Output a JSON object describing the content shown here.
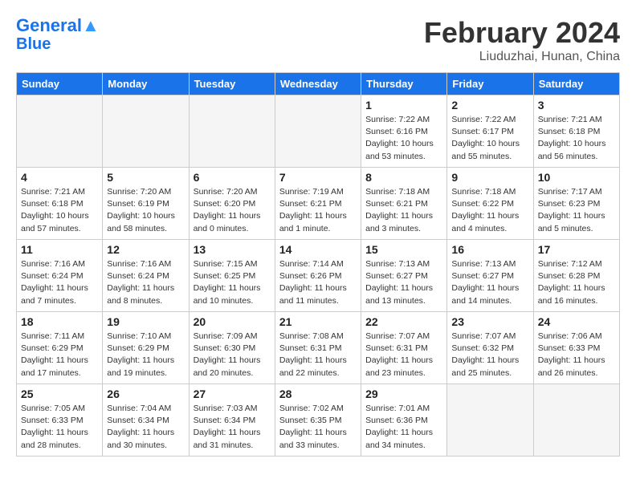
{
  "header": {
    "logo_line1": "General",
    "logo_line2": "Blue",
    "month_year": "February 2024",
    "location": "Liuduzhai, Hunan, China"
  },
  "days_of_week": [
    "Sunday",
    "Monday",
    "Tuesday",
    "Wednesday",
    "Thursday",
    "Friday",
    "Saturday"
  ],
  "weeks": [
    [
      {
        "day": "",
        "empty": true
      },
      {
        "day": "",
        "empty": true
      },
      {
        "day": "",
        "empty": true
      },
      {
        "day": "",
        "empty": true
      },
      {
        "day": "1",
        "sunrise": "7:22 AM",
        "sunset": "6:16 PM",
        "daylight": "10 hours and 53 minutes."
      },
      {
        "day": "2",
        "sunrise": "7:22 AM",
        "sunset": "6:17 PM",
        "daylight": "10 hours and 55 minutes."
      },
      {
        "day": "3",
        "sunrise": "7:21 AM",
        "sunset": "6:18 PM",
        "daylight": "10 hours and 56 minutes."
      }
    ],
    [
      {
        "day": "4",
        "sunrise": "7:21 AM",
        "sunset": "6:18 PM",
        "daylight": "10 hours and 57 minutes."
      },
      {
        "day": "5",
        "sunrise": "7:20 AM",
        "sunset": "6:19 PM",
        "daylight": "10 hours and 58 minutes."
      },
      {
        "day": "6",
        "sunrise": "7:20 AM",
        "sunset": "6:20 PM",
        "daylight": "11 hours and 0 minutes."
      },
      {
        "day": "7",
        "sunrise": "7:19 AM",
        "sunset": "6:21 PM",
        "daylight": "11 hours and 1 minute."
      },
      {
        "day": "8",
        "sunrise": "7:18 AM",
        "sunset": "6:21 PM",
        "daylight": "11 hours and 3 minutes."
      },
      {
        "day": "9",
        "sunrise": "7:18 AM",
        "sunset": "6:22 PM",
        "daylight": "11 hours and 4 minutes."
      },
      {
        "day": "10",
        "sunrise": "7:17 AM",
        "sunset": "6:23 PM",
        "daylight": "11 hours and 5 minutes."
      }
    ],
    [
      {
        "day": "11",
        "sunrise": "7:16 AM",
        "sunset": "6:24 PM",
        "daylight": "11 hours and 7 minutes."
      },
      {
        "day": "12",
        "sunrise": "7:16 AM",
        "sunset": "6:24 PM",
        "daylight": "11 hours and 8 minutes."
      },
      {
        "day": "13",
        "sunrise": "7:15 AM",
        "sunset": "6:25 PM",
        "daylight": "11 hours and 10 minutes."
      },
      {
        "day": "14",
        "sunrise": "7:14 AM",
        "sunset": "6:26 PM",
        "daylight": "11 hours and 11 minutes."
      },
      {
        "day": "15",
        "sunrise": "7:13 AM",
        "sunset": "6:27 PM",
        "daylight": "11 hours and 13 minutes."
      },
      {
        "day": "16",
        "sunrise": "7:13 AM",
        "sunset": "6:27 PM",
        "daylight": "11 hours and 14 minutes."
      },
      {
        "day": "17",
        "sunrise": "7:12 AM",
        "sunset": "6:28 PM",
        "daylight": "11 hours and 16 minutes."
      }
    ],
    [
      {
        "day": "18",
        "sunrise": "7:11 AM",
        "sunset": "6:29 PM",
        "daylight": "11 hours and 17 minutes."
      },
      {
        "day": "19",
        "sunrise": "7:10 AM",
        "sunset": "6:29 PM",
        "daylight": "11 hours and 19 minutes."
      },
      {
        "day": "20",
        "sunrise": "7:09 AM",
        "sunset": "6:30 PM",
        "daylight": "11 hours and 20 minutes."
      },
      {
        "day": "21",
        "sunrise": "7:08 AM",
        "sunset": "6:31 PM",
        "daylight": "11 hours and 22 minutes."
      },
      {
        "day": "22",
        "sunrise": "7:07 AM",
        "sunset": "6:31 PM",
        "daylight": "11 hours and 23 minutes."
      },
      {
        "day": "23",
        "sunrise": "7:07 AM",
        "sunset": "6:32 PM",
        "daylight": "11 hours and 25 minutes."
      },
      {
        "day": "24",
        "sunrise": "7:06 AM",
        "sunset": "6:33 PM",
        "daylight": "11 hours and 26 minutes."
      }
    ],
    [
      {
        "day": "25",
        "sunrise": "7:05 AM",
        "sunset": "6:33 PM",
        "daylight": "11 hours and 28 minutes."
      },
      {
        "day": "26",
        "sunrise": "7:04 AM",
        "sunset": "6:34 PM",
        "daylight": "11 hours and 30 minutes."
      },
      {
        "day": "27",
        "sunrise": "7:03 AM",
        "sunset": "6:34 PM",
        "daylight": "11 hours and 31 minutes."
      },
      {
        "day": "28",
        "sunrise": "7:02 AM",
        "sunset": "6:35 PM",
        "daylight": "11 hours and 33 minutes."
      },
      {
        "day": "29",
        "sunrise": "7:01 AM",
        "sunset": "6:36 PM",
        "daylight": "11 hours and 34 minutes."
      },
      {
        "day": "",
        "empty": true
      },
      {
        "day": "",
        "empty": true
      }
    ]
  ]
}
